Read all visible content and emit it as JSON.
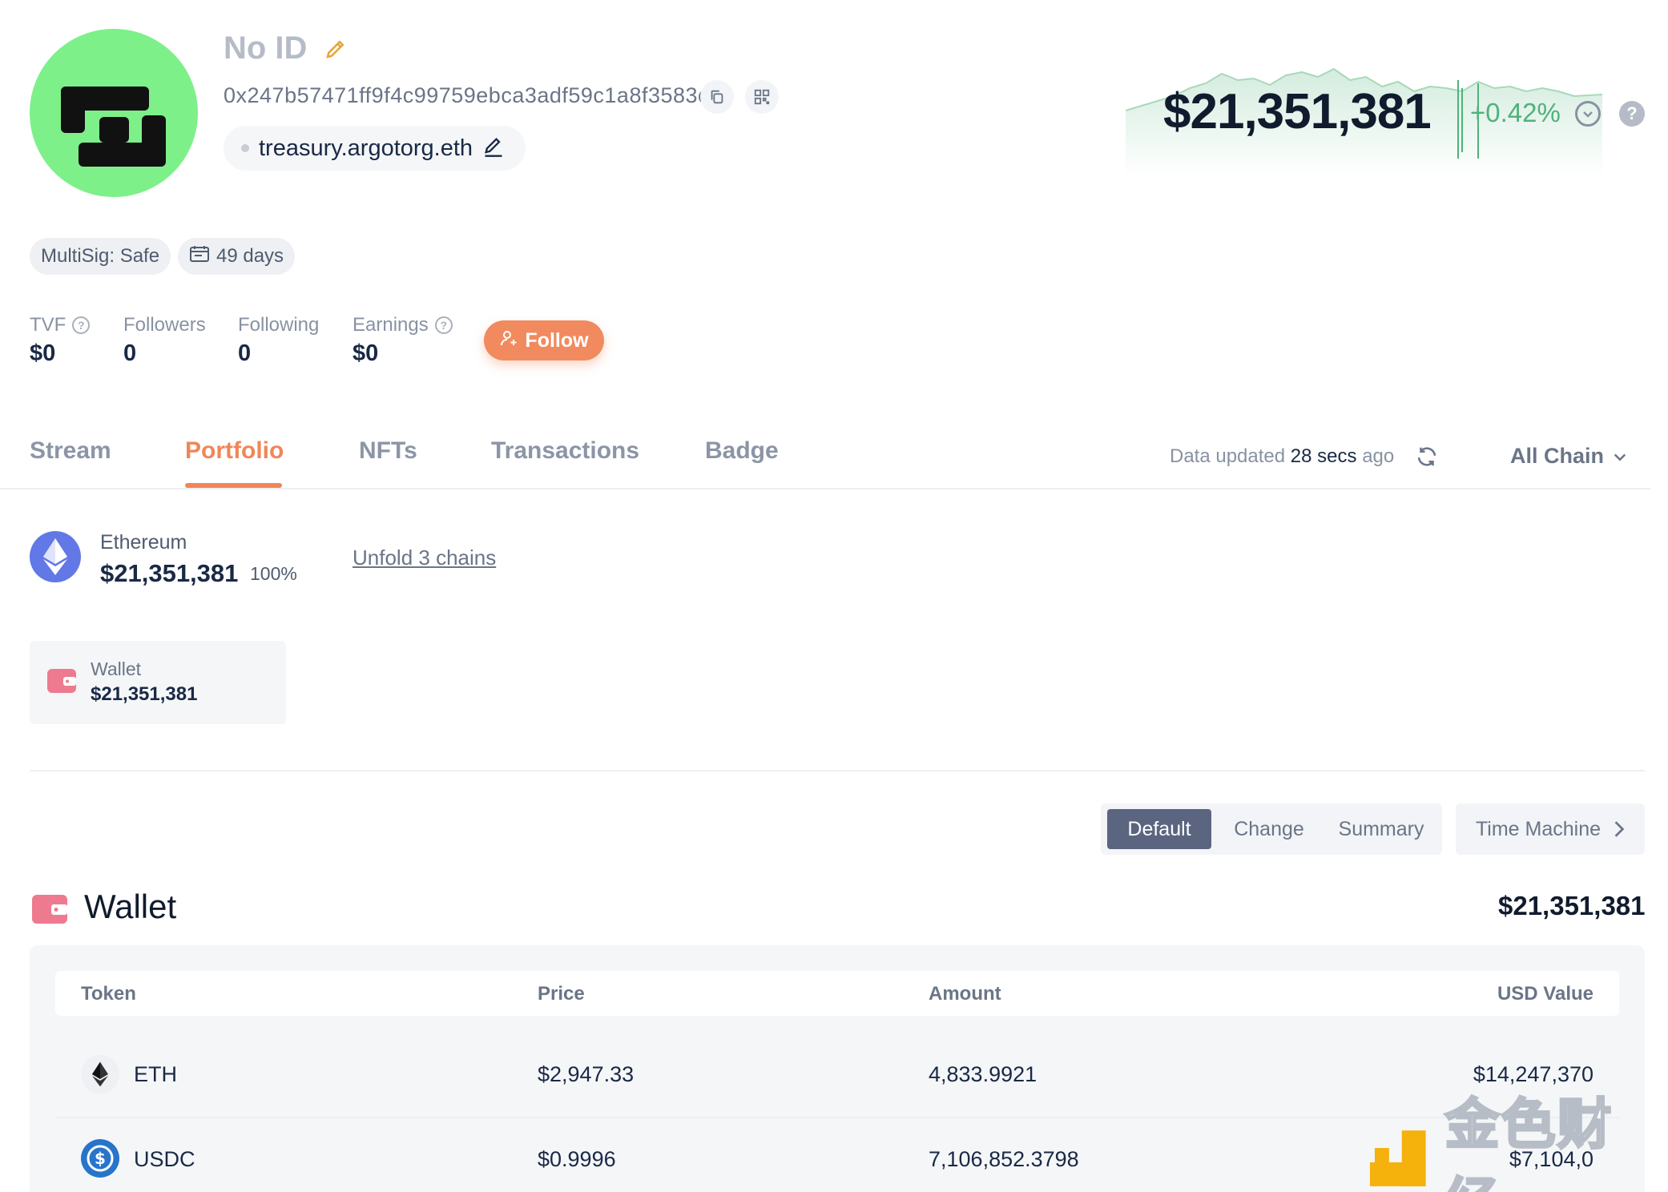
{
  "profile": {
    "name": "No ID",
    "address": "0x247b57471ff9f4c99759ebca3adf59c1a8f3583c",
    "ens": "treasury.argotorg.eth",
    "tags": [
      "MultiSig: Safe",
      "49 days"
    ],
    "avatar_color": "#7df08a"
  },
  "stats": [
    {
      "label": "TVF",
      "value": "$0",
      "help": true
    },
    {
      "label": "Followers",
      "value": "0",
      "help": false
    },
    {
      "label": "Following",
      "value": "0",
      "help": false
    },
    {
      "label": "Earnings",
      "value": "$0",
      "help": true
    }
  ],
  "follow_label": "Follow",
  "net_worth": {
    "value": "$21,351,381",
    "change": "+0.42%",
    "change_color": "#4fb27a"
  },
  "tabs": [
    "Stream",
    "Portfolio",
    "NFTs",
    "Transactions",
    "Badge"
  ],
  "active_tab": "Portfolio",
  "updated": {
    "prefix": "Data updated",
    "time": "28 secs",
    "suffix": "ago"
  },
  "chain_filter": "All Chain",
  "chain_summary": {
    "name": "Ethereum",
    "value": "$21,351,381",
    "percent": "100%",
    "unfold_label": "Unfold 3 chains"
  },
  "wallet_card": {
    "label": "Wallet",
    "value": "$21,351,381"
  },
  "view_modes": [
    "Default",
    "Change",
    "Summary"
  ],
  "active_view": "Default",
  "time_machine_label": "Time Machine",
  "wallet_section": {
    "title": "Wallet",
    "total": "$21,351,381",
    "columns": [
      "Token",
      "Price",
      "Amount",
      "USD Value"
    ],
    "rows": [
      {
        "token": "ETH",
        "price": "$2,947.33",
        "amount": "4,833.9921",
        "usd_value": "$14,247,370",
        "icon": "eth-icon"
      },
      {
        "token": "USDC",
        "price": "$0.9996",
        "amount": "7,106,852.3798",
        "usd_value": "$7,104,0",
        "icon": "usdc-icon"
      }
    ]
  },
  "watermark": "金色财经",
  "colors": {
    "accent": "#f08658",
    "eth": "#6278e6",
    "usdc": "#2775ca",
    "wallet": "#ee7a8f"
  }
}
